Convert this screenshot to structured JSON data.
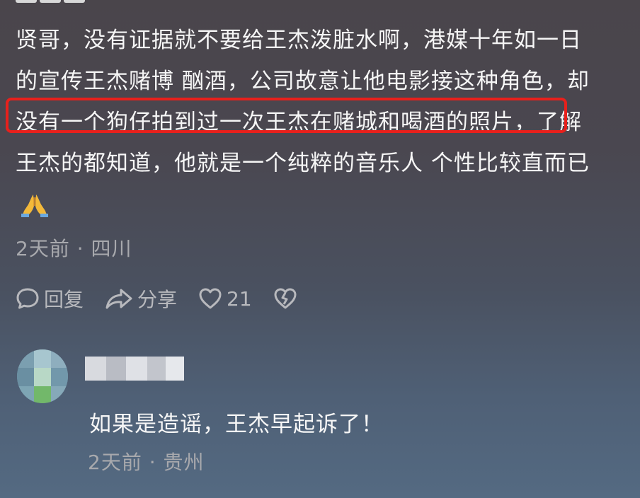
{
  "comment": {
    "lines": [
      "贤哥，没有证据就不要给王杰泼脏水啊，港媒十年如一日",
      "的宣传王杰赌博  酗酒，公司故意让他电影接这种角色，却",
      "没有一个狗仔拍到过一次王杰在赌城和喝酒的照片，了解",
      "王杰的都知道，他就是一个纯粹的音乐人  个性比较直而已"
    ],
    "emoji": "praying-hands-emoji",
    "meta": "2天前 · 四川",
    "highlight_color": "#e8201c"
  },
  "actions": {
    "reply_label": "回复",
    "share_label": "分享",
    "like_count": "21"
  },
  "reply": {
    "text": "如果是造谣，王杰早起诉了！",
    "meta": "2天前 · 贵州"
  }
}
